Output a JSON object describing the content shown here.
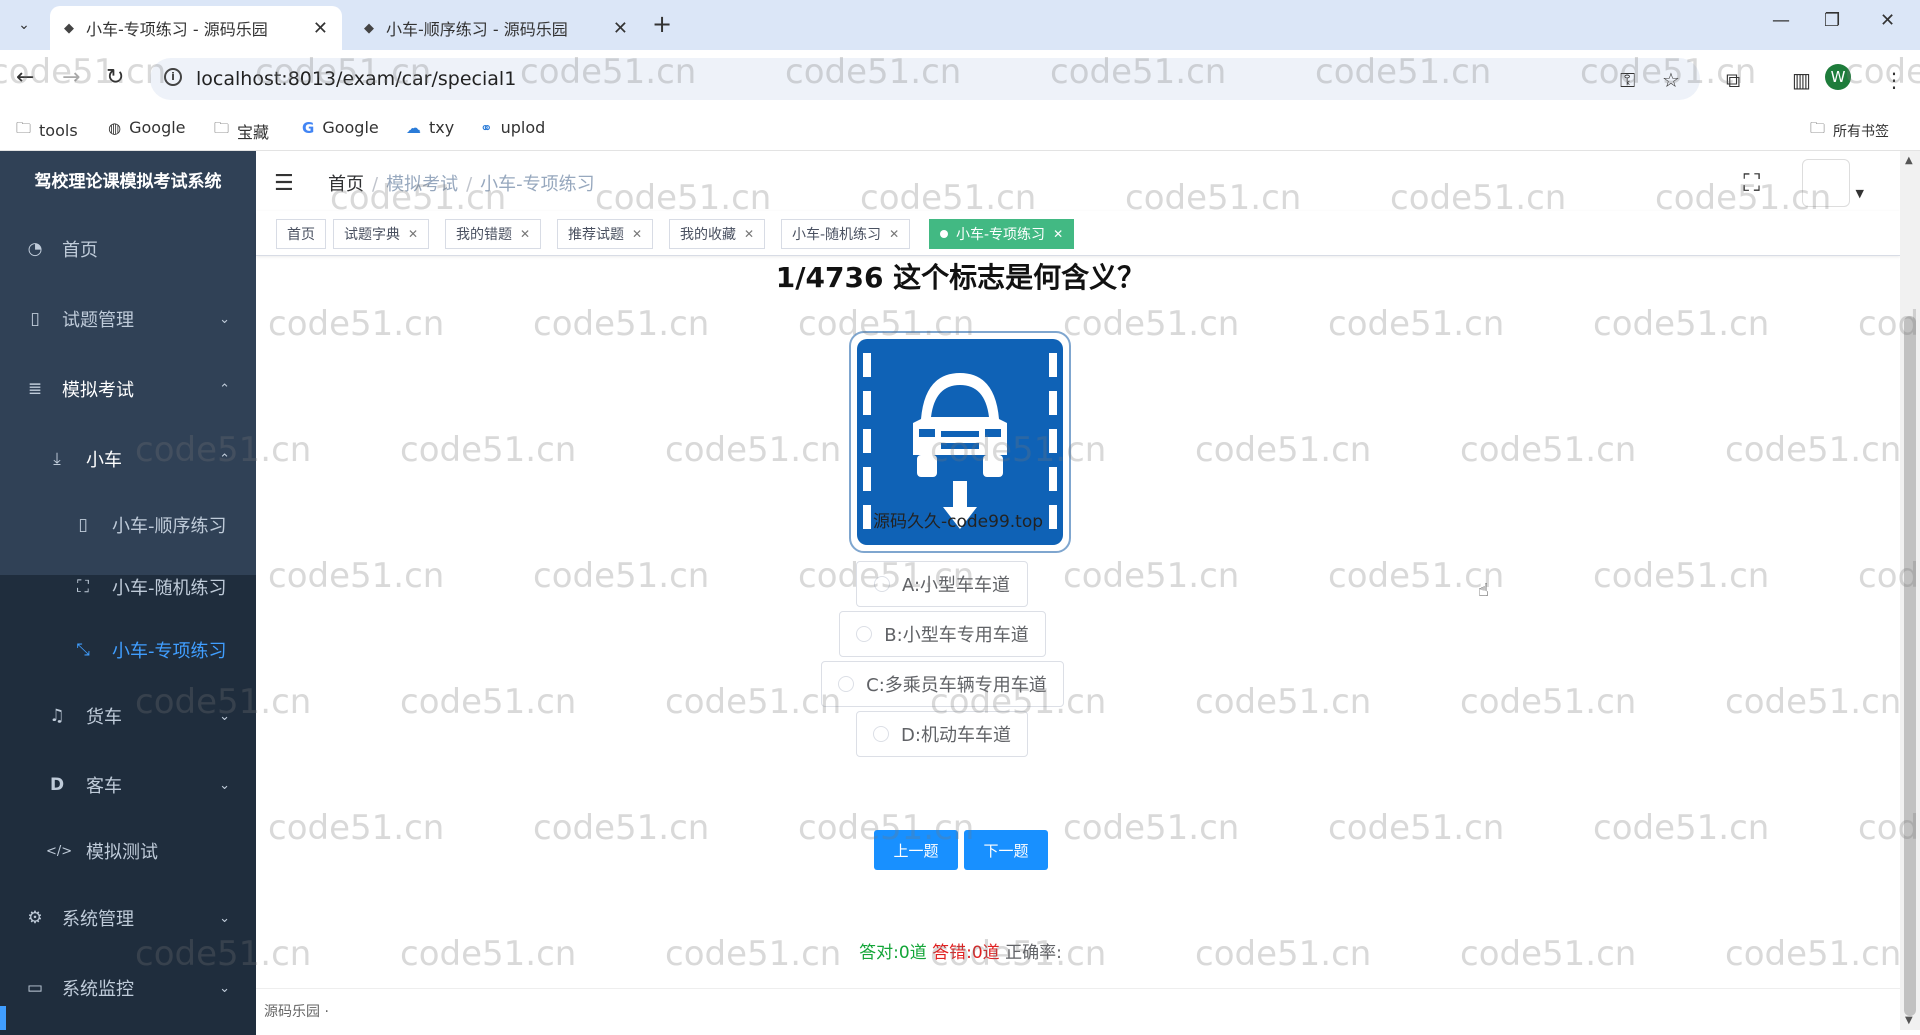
{
  "browser": {
    "tabs": [
      {
        "title": "小车-专项练习 - 源码乐园",
        "active": true
      },
      {
        "title": "小车-顺序练习 - 源码乐园",
        "active": false
      }
    ],
    "url": "localhost:8013/exam/car/special1",
    "profile_initial": "W",
    "bookmarks": [
      "tools",
      "Google",
      "宝藏",
      "Google",
      "txy",
      "uplod"
    ],
    "all_bookmarks": "所有书签"
  },
  "sidebar": {
    "logo": "驾校理论课模拟考试系统",
    "items": [
      {
        "label": "首页",
        "icon": "dashboard-icon"
      },
      {
        "label": "试题管理",
        "icon": "book-icon"
      },
      {
        "label": "模拟考试",
        "icon": "list-icon"
      },
      {
        "label": "小车",
        "icon": "download-icon"
      },
      {
        "label": "小车-顺序练习",
        "icon": "book-icon"
      },
      {
        "label": "小车-随机练习",
        "icon": "fullscreen-icon"
      },
      {
        "label": "小车-专项练习",
        "icon": "shrink-icon"
      },
      {
        "label": "货车",
        "icon": "bell-icon"
      },
      {
        "label": "客车",
        "icon": "d-icon"
      },
      {
        "label": "模拟测试",
        "icon": "code-icon"
      },
      {
        "label": "系统管理",
        "icon": "gear-icon"
      },
      {
        "label": "系统监控",
        "icon": "monitor-icon"
      }
    ]
  },
  "breadcrumb": [
    "首页",
    "模拟考试",
    "小车-专项练习"
  ],
  "tags": [
    {
      "label": "首页",
      "closable": false
    },
    {
      "label": "试题字典",
      "closable": true
    },
    {
      "label": "我的错题",
      "closable": true
    },
    {
      "label": "推荐试题",
      "closable": true
    },
    {
      "label": "我的收藏",
      "closable": true
    },
    {
      "label": "小车-随机练习",
      "closable": true
    },
    {
      "label": "小车-专项练习",
      "closable": true,
      "active": true
    }
  ],
  "question": {
    "text": "1/4736 这个标志是何含义？",
    "image_caption": "源码久久-code99.top",
    "options": [
      "A:小型车车道",
      "B:小型车专用车道",
      "C:多乘员车辆专用车道",
      "D:机动车车道"
    ]
  },
  "buttons": {
    "prev": "上一题",
    "next": "下一题"
  },
  "stats": {
    "correct": "答对:0道",
    "wrong": "答错:0道",
    "rate": "正确率:"
  },
  "footer": "源码乐园 ·",
  "watermark": "code51.cn",
  "colors": {
    "sidebar": "#304156",
    "active_menu": "#409eff",
    "active_tag": "#42b983",
    "button": "#1890ff",
    "sign_blue": "#0f62b6"
  }
}
